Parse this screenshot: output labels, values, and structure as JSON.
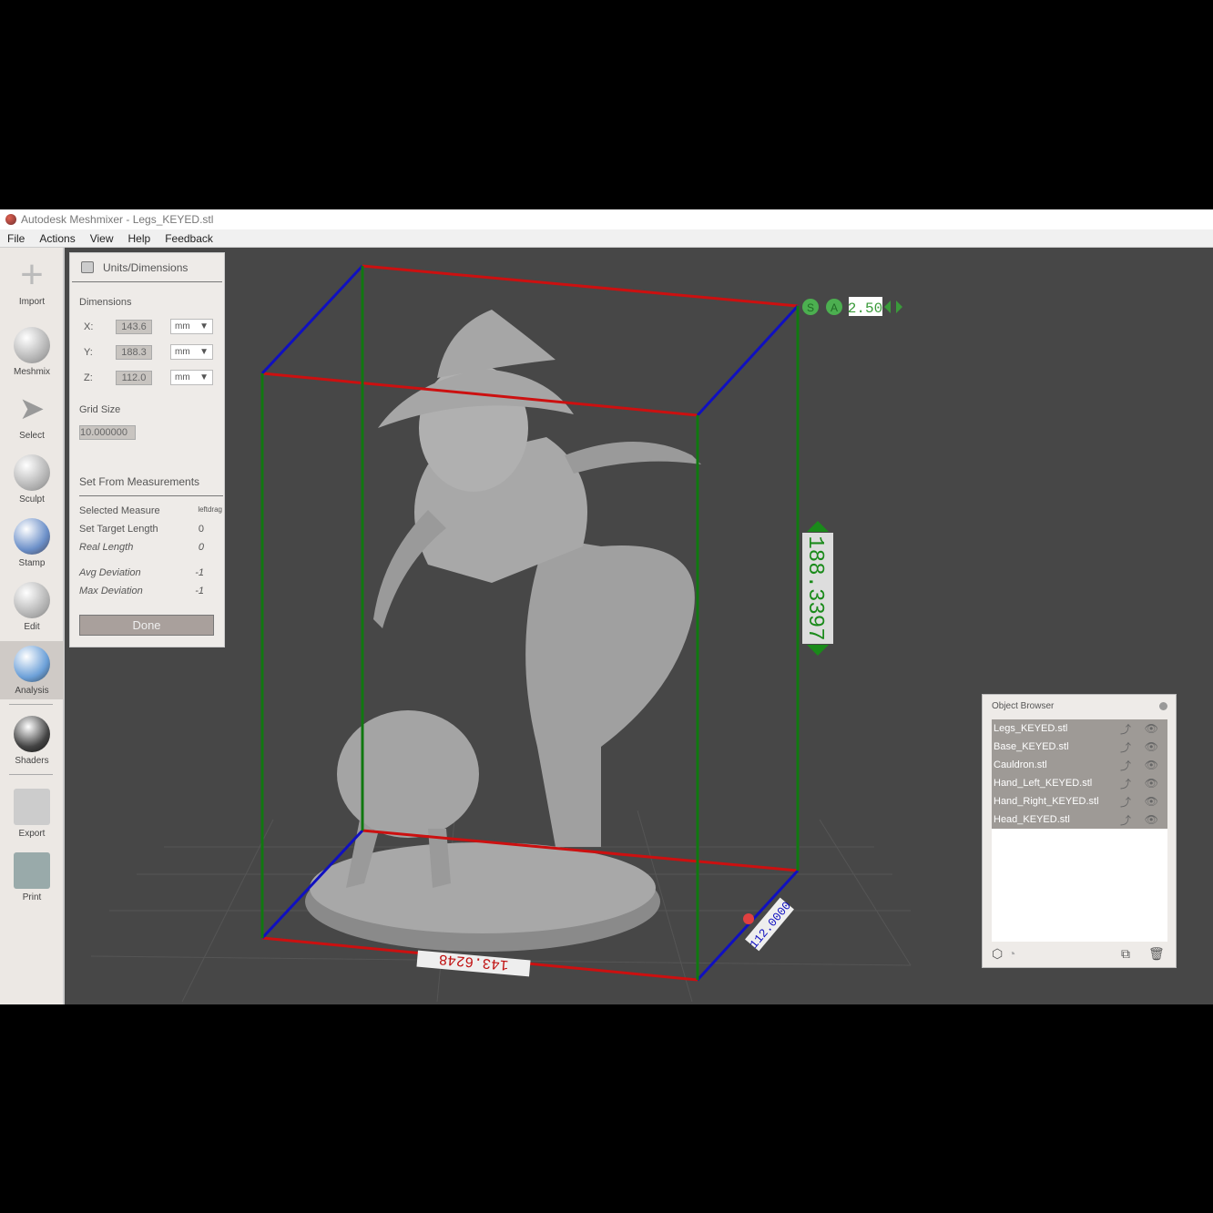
{
  "window": {
    "title": "Autodesk Meshmixer - Legs_KEYED.stl"
  },
  "menu": [
    "File",
    "Actions",
    "View",
    "Help",
    "Feedback"
  ],
  "tools": [
    {
      "label": "Import"
    },
    {
      "label": "Meshmix"
    },
    {
      "label": "Select"
    },
    {
      "label": "Sculpt"
    },
    {
      "label": "Stamp"
    },
    {
      "label": "Edit"
    },
    {
      "label": "Analysis"
    },
    {
      "label": "Shaders"
    },
    {
      "label": "Export"
    },
    {
      "label": "Print"
    }
  ],
  "panel": {
    "title": "Units/Dimensions",
    "dimensions_label": "Dimensions",
    "dims": [
      {
        "axis": "X:",
        "value": "143.6",
        "unit": "mm"
      },
      {
        "axis": "Y:",
        "value": "188.3",
        "unit": "mm"
      },
      {
        "axis": "Z:",
        "value": "112.0",
        "unit": "mm"
      }
    ],
    "grid_label": "Grid Size",
    "grid_value": "10.000000",
    "measure_title": "Set From Measurements",
    "rows": [
      {
        "label": "Selected Measure",
        "value": "leftdrag"
      },
      {
        "label": "Set Target Length",
        "value": "0"
      },
      {
        "label": "Real Length",
        "value": "0"
      },
      {
        "label": "Avg Deviation",
        "value": "-1"
      },
      {
        "label": "Max Deviation",
        "value": "-1"
      }
    ],
    "done": "Done"
  },
  "viewport": {
    "snap": "S",
    "align": "A",
    "step": "2.50",
    "height_label": "188.3397",
    "width_label": "143.6248",
    "depth_label": "112.0000",
    "colors": {
      "x": "#cc1010",
      "y": "#1010c0",
      "z": "#107810"
    }
  },
  "object_browser": {
    "title": "Object Browser",
    "items": [
      "Legs_KEYED.stl",
      "Base_KEYED.stl",
      "Cauldron.stl",
      "Hand_Left_KEYED.stl",
      "Hand_Right_KEYED.stl",
      "Head_KEYED.stl"
    ]
  }
}
